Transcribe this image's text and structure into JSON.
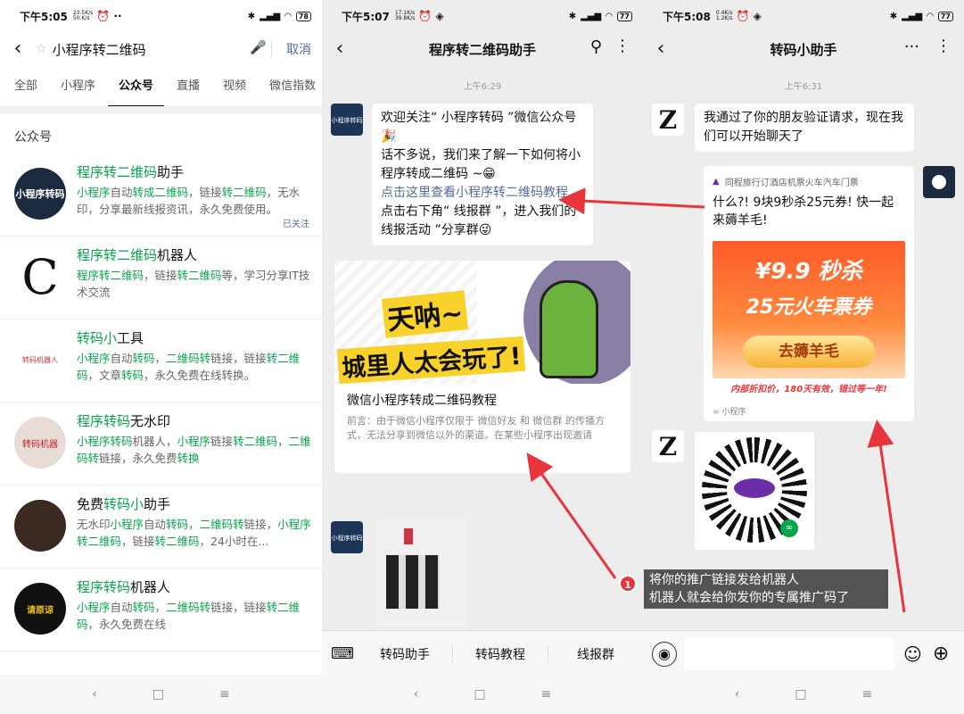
{
  "panel1": {
    "status": {
      "time": "下午5:05",
      "net_top": "23.5K/s",
      "net_bot": "50.K/s",
      "battery": "78"
    },
    "search": {
      "query": "小程序转二维码",
      "cancel_label": "取消"
    },
    "tabs": [
      "全部",
      "小程序",
      "公众号",
      "直播",
      "视频",
      "微信指数"
    ],
    "section_title": "公众号",
    "results": [
      {
        "name_hl": "程序转二维码",
        "name_rest": "助手",
        "name_pre": "",
        "desc": [
          [
            "g",
            "小程序"
          ],
          [
            "",
            "自动"
          ],
          [
            "g",
            "转成二维码"
          ],
          [
            "",
            "，链接"
          ],
          [
            "g",
            "转二维码"
          ],
          [
            "",
            "，无水印，分享最新线报资讯，永久免费使用。"
          ]
        ],
        "followed": "已关注",
        "avatar_text": "小程序转码"
      },
      {
        "name_hl": "程序转二维码",
        "name_rest": "机器人",
        "name_pre": "",
        "desc": [
          [
            "g",
            "程序转二维码"
          ],
          [
            "",
            "，链接"
          ],
          [
            "g",
            "转二维码"
          ],
          [
            "",
            "等，学习分享IT技术交流"
          ]
        ],
        "followed": "",
        "avatar_text": ""
      },
      {
        "name_hl": "转码小",
        "name_rest": "工具",
        "name_pre": "",
        "desc": [
          [
            "g",
            "小程序"
          ],
          [
            "",
            "自动"
          ],
          [
            "g",
            "转码"
          ],
          [
            "",
            "，"
          ],
          [
            "g",
            "二维码转"
          ],
          [
            "",
            "链接，链接"
          ],
          [
            "g",
            "转二维码"
          ],
          [
            "",
            "，文章"
          ],
          [
            "g",
            "转码"
          ],
          [
            "",
            "，永久免费在线转换。"
          ]
        ],
        "followed": "",
        "avatar_text": "转码机器人"
      },
      {
        "name_hl": "程序转码",
        "name_rest": "无水印",
        "name_pre": "",
        "desc": [
          [
            "g",
            "小程序转码"
          ],
          [
            "",
            "机器人，"
          ],
          [
            "g",
            "小程序"
          ],
          [
            "",
            "链接"
          ],
          [
            "g",
            "转二维码"
          ],
          [
            "",
            "，"
          ],
          [
            "g",
            "二维码转"
          ],
          [
            "",
            "链接，永久免费"
          ],
          [
            "g",
            "转换"
          ]
        ],
        "followed": "",
        "avatar_text": "转码机器"
      },
      {
        "name_hl": "转码小",
        "name_rest": "助手",
        "name_pre": "免费",
        "desc": [
          [
            "",
            "无水印"
          ],
          [
            "g",
            "小程序"
          ],
          [
            "",
            "自动"
          ],
          [
            "g",
            "转码"
          ],
          [
            "",
            "，"
          ],
          [
            "g",
            "二维码转"
          ],
          [
            "",
            "链接，"
          ],
          [
            "g",
            "小程序转二维码"
          ],
          [
            "",
            "，链接"
          ],
          [
            "g",
            "转二维码"
          ],
          [
            "",
            "，24小时在..."
          ]
        ],
        "followed": "",
        "avatar_text": ""
      },
      {
        "name_hl": "程序转码",
        "name_rest": "机器人",
        "name_pre": "",
        "desc": [
          [
            "g",
            "小程序"
          ],
          [
            "",
            "自动"
          ],
          [
            "g",
            "转码"
          ],
          [
            "",
            "，"
          ],
          [
            "g",
            "二维码转"
          ],
          [
            "",
            "链接，链接"
          ],
          [
            "g",
            "转二维码"
          ],
          [
            "",
            "，永久免费在线"
          ]
        ],
        "followed": "",
        "avatar_text": "请原谅"
      }
    ]
  },
  "panel2": {
    "status": {
      "time": "下午5:07",
      "net_top": "17.1K/s",
      "net_bot": "39.8K/s",
      "battery": "77"
    },
    "title": "程序转二维码助手",
    "time_label": "上午6:29",
    "welcome": {
      "l1": "欢迎关注“ 小程序转码 ”微信公众号🎉",
      "l2": "话不多说，我们来了解一下如何将小程序转成二维码 ~😁",
      "link": "点击这里查看小程序转二维码教程",
      "l3": "点击右下角“ 线报群 ”，进入我们的“ 线报活动 ”分享群😜"
    },
    "banner_line1": "天呐~",
    "banner_line2": "城里人太会玩了!",
    "card_title": "微信小程序转成二维码教程",
    "card_desc": "前言：由于微信小程序仅限于 微信好友 和 微信群 的传播方式，无法分享到微信以外的渠道。在某些小程序出现邀请",
    "menu": [
      "转码助手",
      "转码教程",
      "线报群"
    ]
  },
  "panel3": {
    "status": {
      "time": "下午5:08",
      "net_top": "0.4K/s",
      "net_bot": "1.2K/s",
      "battery": "77"
    },
    "title": "转码小助手",
    "time_label": "上午6:31",
    "greeting": "我通过了你的朋友验证请求，现在我们可以开始聊天了",
    "mini_source": "同程旅行订酒店机票火车汽车门票",
    "mini_text": "什么?! 9块9秒杀25元券! 快一起来薅羊毛!",
    "promo_price": "¥9.9 秒杀",
    "promo_sub": "25元火车票券",
    "promo_btn": "去薅羊毛",
    "promo_foot": "内部折扣价，180天有效，错过等一年!",
    "mini_tag": "小程序"
  },
  "annotation": {
    "number": "1",
    "line1": "将你的推广链接发给机器人",
    "line2": "机器人就会给你发你的专属推广码了"
  },
  "colors": {
    "accent_green": "#07a54a",
    "link_blue": "#576b95",
    "arrow_red": "#e8343b",
    "chat_bg": "#ededed"
  }
}
